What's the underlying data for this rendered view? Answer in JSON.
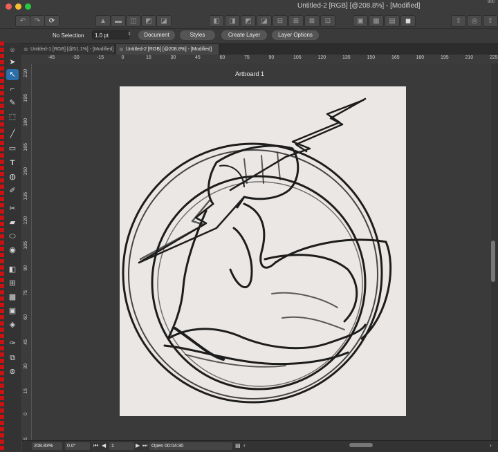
{
  "window": {
    "title": "Untitled-2 [RGB] [@208.8%] - [Modified]",
    "wifi_label": "900"
  },
  "context_bar": {
    "selection_label": "No Selection",
    "stroke_width": "1.0 pt",
    "document_button": "Document",
    "styles_button": "Styles",
    "create_layer_button": "Create Layer",
    "layer_options_button": "Layer Options"
  },
  "tabs": [
    {
      "label": "Untitled-1 [RGB] [@51.1%] - [Modified]"
    },
    {
      "label": "Untitled-2 [RGB] [@208.8%] - [Modified]"
    }
  ],
  "rulers": {
    "horizontal": [
      "-45",
      "-30",
      "-15",
      "0",
      "15",
      "30",
      "45",
      "60",
      "75",
      "90",
      "105",
      "120",
      "135",
      "150",
      "165",
      "180",
      "195",
      "210",
      "225"
    ],
    "vertical": [
      "210",
      "195",
      "180",
      "165",
      "150",
      "135",
      "120",
      "105",
      "90",
      "75",
      "60",
      "45",
      "30",
      "15",
      "0",
      "-15"
    ]
  },
  "canvas": {
    "artboard_label": "Artboard 1"
  },
  "status_bar": {
    "zoom": "208.83%",
    "rotation": "0.0°",
    "page": "1",
    "open_time": "Open 00:04:30"
  },
  "icons": {
    "tools": [
      "arrow-icon",
      "node-icon",
      "corner-icon",
      "pen-icon",
      "marquee-icon",
      "line-icon",
      "rect-icon",
      "text-icon",
      "fill-icon",
      "brush-icon",
      "knife-icon",
      "eraser-icon",
      "shape-icon",
      "eye-icon",
      "gradient-icon",
      "transform-icon",
      "pattern-icon",
      "mask-icon",
      "layers-icon",
      "crop-icon",
      "slice-icon",
      "zoom-icon"
    ]
  }
}
